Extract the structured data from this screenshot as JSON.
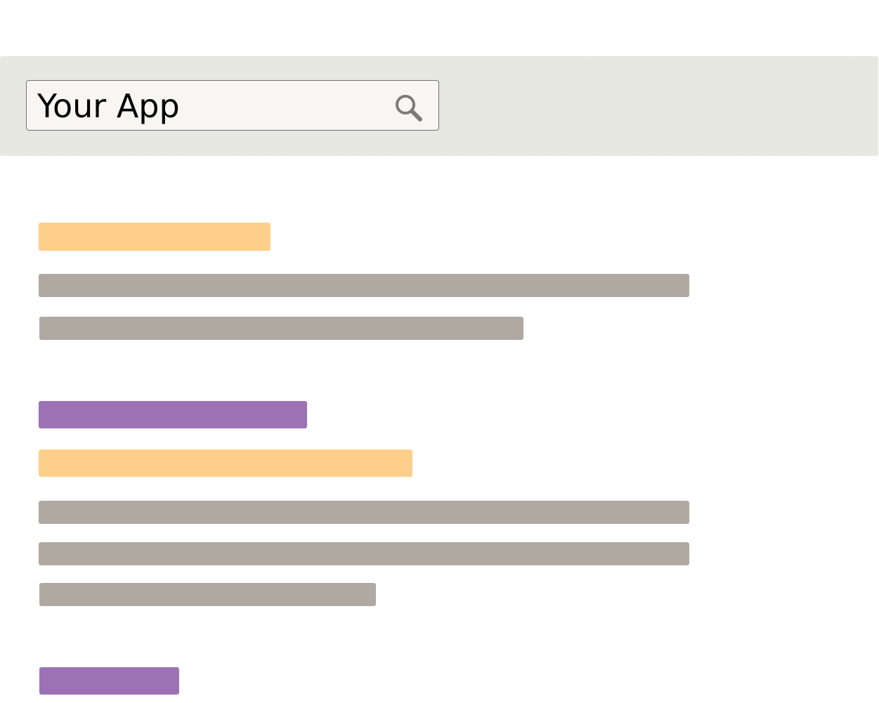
{
  "header": {
    "search": {
      "value": "Your App",
      "icon": "search-icon"
    }
  },
  "colors": {
    "header_bg": "#e7e7e2",
    "heading_orange": "#fdcf8a",
    "heading_purple": "#9c72b5",
    "text_placeholder": "#b0a9a2",
    "icon": "#7b7b7b"
  }
}
